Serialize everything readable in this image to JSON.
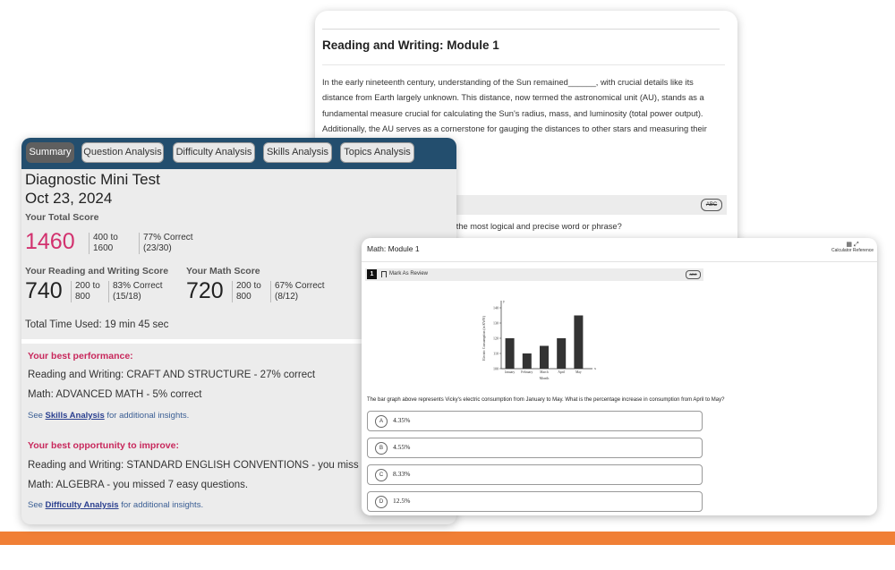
{
  "reading_writing": {
    "title": "Reading and Writing: Module 1",
    "passage": "In the early nineteenth century, understanding of the Sun remained______, with crucial details like its distance from Earth largely unknown. This distance, now termed the astronomical unit (AU), stands as a fundamental measure crucial for calculating the Sun's radius, mass, and luminosity (total power output). Additionally, the AU serves as a cornerstone for gauging the distances to other stars and measuring their",
    "strike_label": "ABC",
    "question_fragment": "n the most logical and precise word or phrase?"
  },
  "score_report": {
    "tabs": [
      {
        "label": "Summary",
        "active": true
      },
      {
        "label": "Question Analysis",
        "active": false
      },
      {
        "label": "Difficulty Analysis",
        "active": false
      },
      {
        "label": "Skills Analysis",
        "active": false
      },
      {
        "label": "Topics Analysis",
        "active": false
      }
    ],
    "test_name": "Diagnostic Mini Test",
    "test_date": "Oct 23, 2024",
    "total": {
      "label": "Your Total Score",
      "score": "1460",
      "range": "400 to 1600",
      "percent": "77% Correct",
      "fraction": "(23/30)"
    },
    "reading_writing": {
      "label": "Your Reading and Writing Score",
      "score": "740",
      "range": "200 to 800",
      "percent": "83% Correct",
      "fraction": "(15/18)"
    },
    "math": {
      "label": "Your Math Score",
      "score": "720",
      "range": "200 to 800",
      "percent": "67% Correct",
      "fraction": "(8/12)"
    },
    "time_used": "Total Time Used: 19 min 45 sec",
    "best_performance": {
      "heading": "Your best performance:",
      "items": [
        "Reading and Writing: CRAFT AND STRUCTURE - 27% correct",
        "Math: ADVANCED MATH - 5% correct"
      ],
      "see_prefix": "See ",
      "see_link": "Skills Analysis",
      "see_suffix": " for additional insights."
    },
    "best_opportunity": {
      "heading": "Your best opportunity to improve:",
      "items": [
        "Reading and Writing: STANDARD ENGLISH CONVENTIONS - you miss",
        "Math: ALGEBRA - you missed 7 easy questions."
      ],
      "see_prefix": "See ",
      "see_link": "Difficulty Analysis",
      "see_suffix": " for additional insights."
    }
  },
  "math_module": {
    "title": "Math: Module 1",
    "calculator_label": "Calculator Reference",
    "question_number": "1",
    "mark_review": "Mark As Review",
    "strike_label": "ABC",
    "question": "The bar graph above represents Vicky's electric consumption from January to May. What is the percentage increase in consumption from April to May?",
    "choices": [
      {
        "letter": "A",
        "value": "4.35%"
      },
      {
        "letter": "B",
        "value": "4.55%"
      },
      {
        "letter": "C",
        "value": "8.33%"
      },
      {
        "letter": "D",
        "value": "12.5%"
      }
    ]
  },
  "chart_data": {
    "type": "bar",
    "categories": [
      "January",
      "February",
      "March",
      "April",
      "May"
    ],
    "values": [
      120,
      110,
      115,
      120,
      135
    ],
    "xlabel": "Month",
    "ylabel": "Electric Consumption (in KWH)",
    "y_axis_letter": "y",
    "x_axis_letter": "x",
    "ylim": [
      100,
      140
    ],
    "yticks": [
      100,
      110,
      120,
      130,
      140
    ],
    "bar_color": "#333333",
    "grid": false
  }
}
